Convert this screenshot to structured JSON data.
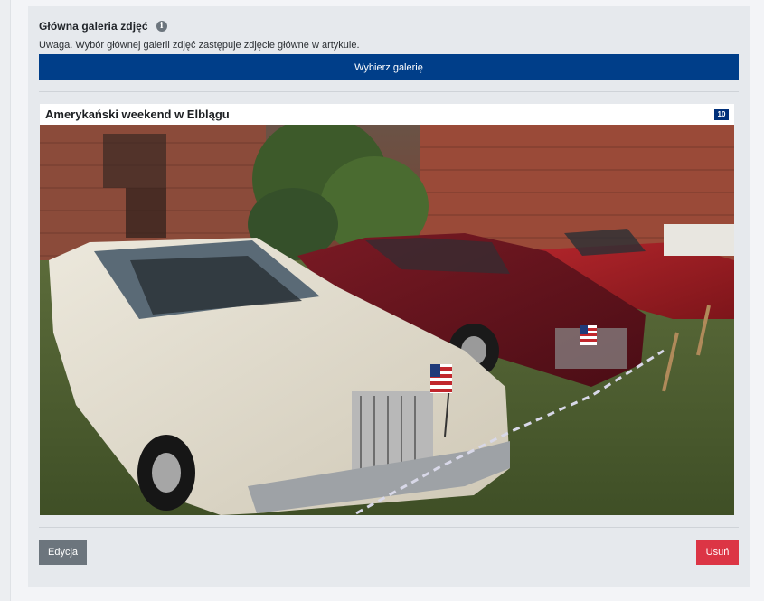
{
  "section": {
    "title": "Główna galeria zdjęć",
    "info_icon": "info-icon",
    "note": "Uwaga. Wybór głównej galerii zdjęć zastępuje zdjęcie główne w artykule."
  },
  "actions": {
    "choose_gallery_label": "Wybierz galerię",
    "edit_label": "Edycja",
    "delete_label": "Usuń"
  },
  "gallery": {
    "title": "Amerykański weekend w Elblągu",
    "photo_count": "10",
    "photo_alt": "Klasyczne amerykańskie samochody przed ceglanymi ruinami"
  },
  "colors": {
    "primary": "#003e89",
    "secondary": "#6c757d",
    "danger": "#dc3545",
    "panel": "#e6e9ed"
  }
}
